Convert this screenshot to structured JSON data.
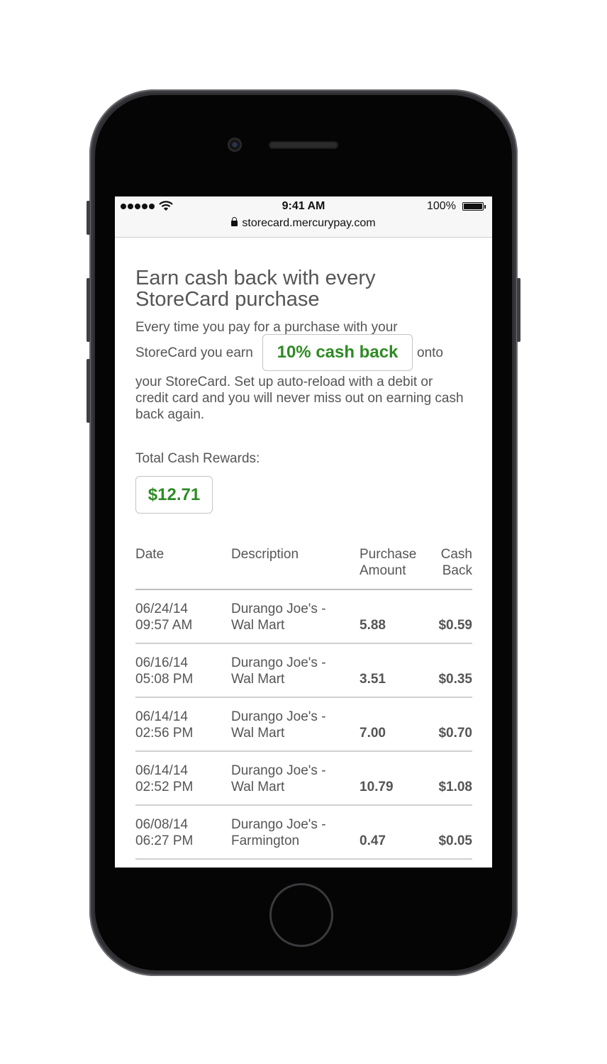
{
  "status_bar": {
    "time": "9:41 AM",
    "battery": "100%",
    "url": "storecard.mercurypay.com",
    "icons": [
      "signal-dots-icon",
      "wifi-icon",
      "battery-icon",
      "lock-icon"
    ]
  },
  "promo": {
    "headline": "Earn cash back with every StoreCard purchase",
    "text_line1": "Every time you pay for a purchase with your",
    "text_pre": "StoreCard you earn",
    "badge": "10% cash back",
    "text_post": "onto",
    "text_rest": "your StoreCard. Set up auto-reload with a debit or credit card and you will never miss out on earning cash back again."
  },
  "rewards": {
    "label": "Total Cash Rewards:",
    "total": "$12.71"
  },
  "table": {
    "headers": {
      "date": "Date",
      "description": "Description",
      "purchase_amount": "Purchase Amount",
      "cash_back": "Cash Back"
    },
    "rows": [
      {
        "date": "06/24/14",
        "time": "09:57 AM",
        "desc1": "Durango Joe's -",
        "desc2": "Wal Mart",
        "amount": "5.88",
        "cash_back": "$0.59"
      },
      {
        "date": "06/16/14",
        "time": "05:08 PM",
        "desc1": "Durango Joe's -",
        "desc2": "Wal Mart",
        "amount": "3.51",
        "cash_back": "$0.35"
      },
      {
        "date": "06/14/14",
        "time": "02:56 PM",
        "desc1": "Durango Joe's -",
        "desc2": "Wal Mart",
        "amount": "7.00",
        "cash_back": "$0.70"
      },
      {
        "date": "06/14/14",
        "time": "02:52 PM",
        "desc1": "Durango Joe's -",
        "desc2": "Wal Mart",
        "amount": "10.79",
        "cash_back": "$1.08"
      },
      {
        "date": "06/08/14",
        "time": "06:27 PM",
        "desc1": "Durango Joe's -",
        "desc2": "Farmington",
        "amount": "0.47",
        "cash_back": "$0.05"
      }
    ]
  },
  "colors": {
    "accent_green": "#2e8b24",
    "text_gray": "#555555",
    "phone_frame": "#2f2f32"
  }
}
